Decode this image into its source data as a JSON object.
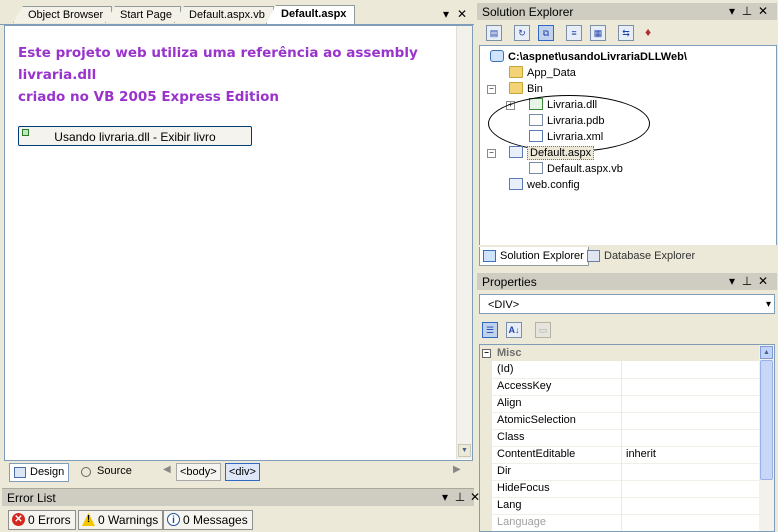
{
  "editor": {
    "tabs": [
      "Object Browser",
      "Start Page",
      "Default.aspx.vb",
      "Default.aspx"
    ],
    "active_tab": "Default.aspx",
    "window_buttons": {
      "dropdown": "▾",
      "close": "✕"
    },
    "content_lines": [
      "Este projeto web utiliza uma referência ao assembly",
      "livraria.dll",
      "criado no VB 2005 Express Edition"
    ],
    "button_label": "Usando livraria.dll - Exibir livro",
    "views": {
      "design": "Design",
      "source": "Source"
    },
    "tags": [
      "<body>",
      "<div>"
    ]
  },
  "error_list": {
    "title": "Error List",
    "errors": "0 Errors",
    "warnings": "0 Warnings",
    "messages": "0 Messages"
  },
  "solution_explorer": {
    "title": "Solution Explorer",
    "tree": {
      "project": "C:\\aspnet\\usandoLivrariaDLLWeb\\",
      "app_data": "App_Data",
      "bin": "Bin",
      "livraria_dll": "Livraria.dll",
      "livraria_pdb": "Livraria.pdb",
      "livraria_xml": "Livraria.xml",
      "default_aspx": "Default.aspx",
      "default_aspx_vb": "Default.aspx.vb",
      "web_config": "web.config"
    },
    "tabs": [
      "Solution Explorer",
      "Database Explorer"
    ]
  },
  "properties": {
    "title": "Properties",
    "selected_object": "<DIV>",
    "category": "Misc",
    "rows": [
      {
        "name": "(Id)",
        "value": ""
      },
      {
        "name": "AccessKey",
        "value": ""
      },
      {
        "name": "Align",
        "value": ""
      },
      {
        "name": "AtomicSelection",
        "value": ""
      },
      {
        "name": "Class",
        "value": ""
      },
      {
        "name": "ContentEditable",
        "value": "inherit"
      },
      {
        "name": "Dir",
        "value": ""
      },
      {
        "name": "HideFocus",
        "value": ""
      },
      {
        "name": "Lang",
        "value": ""
      },
      {
        "name": "Language",
        "value": ""
      }
    ]
  },
  "colors": {
    "design_text": "#9933cc",
    "chrome": "#ece9d8",
    "pane_header": "#cfcdc2",
    "border": "#7f9db9"
  }
}
